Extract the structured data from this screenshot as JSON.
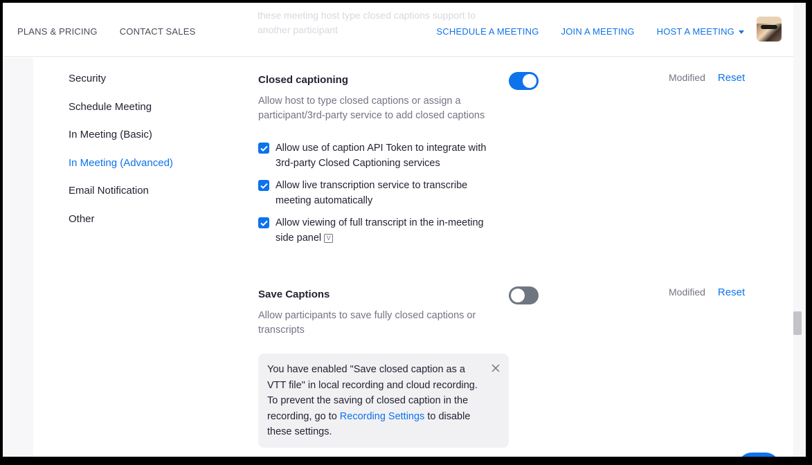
{
  "header": {
    "ghost_text": "these meeting host type closed captions support to another participant",
    "nav_left": [
      "PLANS & PRICING",
      "CONTACT SALES"
    ],
    "schedule": "SCHEDULE A MEETING",
    "join": "JOIN A MEETING",
    "host": "HOST A MEETING",
    "accent_color": "#0e72ed"
  },
  "sidebar": {
    "items": [
      {
        "label": "Security"
      },
      {
        "label": "Schedule Meeting"
      },
      {
        "label": "In Meeting (Basic)"
      },
      {
        "label": "In Meeting (Advanced)",
        "active": true
      },
      {
        "label": "Email Notification"
      },
      {
        "label": "Other"
      }
    ]
  },
  "closed_captioning": {
    "title": "Closed captioning",
    "description": "Allow host to type closed captions or assign a participant/3rd-party service to add closed captions",
    "enabled": true,
    "modified": "Modified",
    "reset": "Reset",
    "options": [
      {
        "label": "Allow use of caption API Token to integrate with 3rd-party Closed Captioning services",
        "checked": true
      },
      {
        "label": "Allow live transcription service to transcribe meeting automatically",
        "checked": true
      },
      {
        "label": "Allow viewing of full transcript in the in-meeting side panel",
        "checked": true,
        "icon": "version-badge-icon"
      }
    ]
  },
  "save_captions": {
    "title": "Save Captions",
    "description": "Allow participants to save fully closed captions or transcripts",
    "enabled": false,
    "modified": "Modified",
    "reset": "Reset",
    "notice": {
      "text": "You have enabled \"Save closed caption as a VTT file\" in local recording and cloud recording. To prevent the saving of closed caption in the recording, go to ",
      "link": "Recording Settings",
      "text_after": " to disable these settings."
    }
  }
}
